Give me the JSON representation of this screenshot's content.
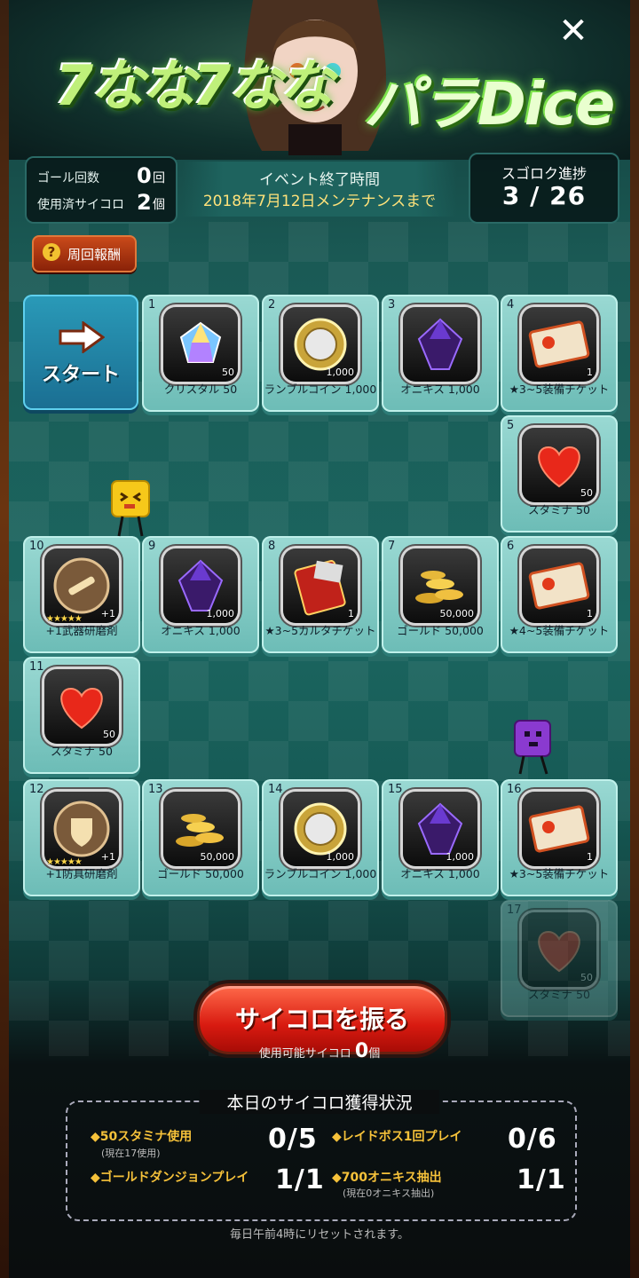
{
  "header": {
    "title_left": "7なな7なな",
    "title_right": "パラDice",
    "close_icon": "close-icon"
  },
  "stats": {
    "goal_label": "ゴール回数",
    "goal_value": "0",
    "goal_unit": "回",
    "used_dice_label": "使用済サイコロ",
    "used_dice_value": "2",
    "used_dice_unit": "個"
  },
  "event": {
    "label": "イベント終了時間",
    "end": "2018年7月12日メンテナンスまで"
  },
  "progress": {
    "label": "スゴロク進捗",
    "value": "3 / 26"
  },
  "lap_button": {
    "icon": "question-icon",
    "icon_text": "?",
    "label": "周回報酬"
  },
  "start_tile": {
    "label": "スタート"
  },
  "tiles": [
    {
      "num": "1",
      "label": "クリスタル 50",
      "qty": "50",
      "icon": "crystal-icon"
    },
    {
      "num": "2",
      "label": "ランブルコイン 1,000",
      "qty": "1,000",
      "icon": "coin-icon"
    },
    {
      "num": "3",
      "label": "オニキス 1,000",
      "qty": "",
      "icon": "onyx-icon"
    },
    {
      "num": "4",
      "label": "★3~5装備チケット",
      "qty": "1",
      "icon": "ticket-icon"
    },
    {
      "num": "5",
      "label": "スタミナ 50",
      "qty": "50",
      "icon": "heart-icon"
    },
    {
      "num": "6",
      "label": "★4~5装備チケット",
      "qty": "1",
      "icon": "ticket-icon"
    },
    {
      "num": "7",
      "label": "ゴールド 50,000",
      "qty": "50,000",
      "icon": "gold-icon"
    },
    {
      "num": "8",
      "label": "★3~5カルタチケット",
      "qty": "1",
      "icon": "card-ticket-icon"
    },
    {
      "num": "9",
      "label": "オニキス 1,000",
      "qty": "1,000",
      "icon": "onyx-icon"
    },
    {
      "num": "10",
      "label": "+1武器研磨剤",
      "qty": "+1",
      "icon": "weapon-polish-icon",
      "stars": "★★★★★"
    },
    {
      "num": "11",
      "label": "スタミナ 50",
      "qty": "50",
      "icon": "heart-icon"
    },
    {
      "num": "12",
      "label": "+1防具研磨剤",
      "qty": "+1",
      "icon": "armor-polish-icon",
      "stars": "★★★★★"
    },
    {
      "num": "13",
      "label": "ゴールド 50,000",
      "qty": "50,000",
      "icon": "gold-icon"
    },
    {
      "num": "14",
      "label": "ランブルコイン 1,000",
      "qty": "1,000",
      "icon": "coin-icon"
    },
    {
      "num": "15",
      "label": "オニキス 1,000",
      "qty": "1,000",
      "icon": "onyx-icon"
    },
    {
      "num": "16",
      "label": "★3~5装備チケット",
      "qty": "1",
      "icon": "ticket-icon"
    },
    {
      "num": "17",
      "label": "スタミナ 50",
      "qty": "50",
      "icon": "heart-icon"
    }
  ],
  "roll": {
    "label": "サイコロを振る",
    "available_label": "使用可能サイコロ",
    "available_value": "0",
    "available_unit": "個"
  },
  "daily": {
    "title": "本日のサイコロ獲得状況",
    "items": [
      {
        "label": "◆50スタミナ使用",
        "sub": "(現在17使用)",
        "value": "0/5"
      },
      {
        "label": "◆レイドボス1回プレイ",
        "sub": "",
        "value": "0/6"
      },
      {
        "label": "◆ゴールドダンジョンプレイ",
        "sub": "",
        "value": "1/1"
      },
      {
        "label": "◆700オニキス抽出",
        "sub": "(現在0オニキス抽出)",
        "value": "1/1"
      }
    ],
    "reset_note": "毎日午前4時にリセットされます。"
  }
}
